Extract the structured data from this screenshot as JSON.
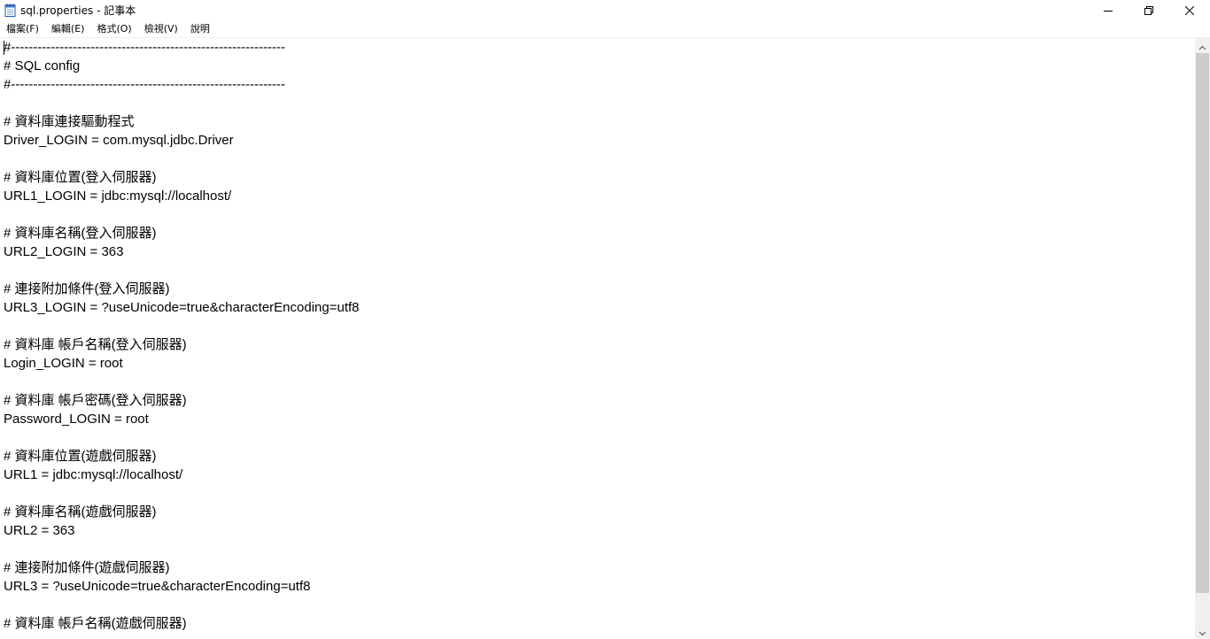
{
  "window": {
    "title": "sql.properties - 記事本",
    "app_icon": "notepad-icon"
  },
  "caption": {
    "minimize_icon": "minimize-icon",
    "restore_icon": "restore-icon",
    "close_icon": "close-icon"
  },
  "menu": {
    "items": [
      {
        "label": "檔案(F)"
      },
      {
        "label": "編輯(E)"
      },
      {
        "label": "格式(O)"
      },
      {
        "label": "檢視(V)"
      },
      {
        "label": "說明"
      }
    ]
  },
  "editor": {
    "lines": [
      "#--------------------------------------------------------------",
      "# SQL config",
      "#--------------------------------------------------------------",
      "",
      "# 資料庫連接驅動程式",
      "Driver_LOGIN = com.mysql.jdbc.Driver",
      "",
      "# 資料庫位置(登入伺服器)",
      "URL1_LOGIN = jdbc:mysql://localhost/",
      "",
      "# 資料庫名稱(登入伺服器)",
      "URL2_LOGIN = 363",
      "",
      "# 連接附加條件(登入伺服器)",
      "URL3_LOGIN = ?useUnicode=true&characterEncoding=utf8",
      "",
      "# 資料庫 帳戶名稱(登入伺服器)",
      "Login_LOGIN = root",
      "",
      "# 資料庫 帳戶密碼(登入伺服器)",
      "Password_LOGIN = root",
      "",
      "# 資料庫位置(遊戲伺服器)",
      "URL1 = jdbc:mysql://localhost/",
      "",
      "# 資料庫名稱(遊戲伺服器)",
      "URL2 = 363",
      "",
      "# 連接附加條件(遊戲伺服器)",
      "URL3 = ?useUnicode=true&characterEncoding=utf8",
      "",
      "# 資料庫 帳戶名稱(遊戲伺服器)"
    ]
  },
  "colors": {
    "background": "#ffffff",
    "text": "#000000",
    "scrollbar_track": "#f0f0f0",
    "scrollbar_thumb": "#cdcdcd"
  }
}
